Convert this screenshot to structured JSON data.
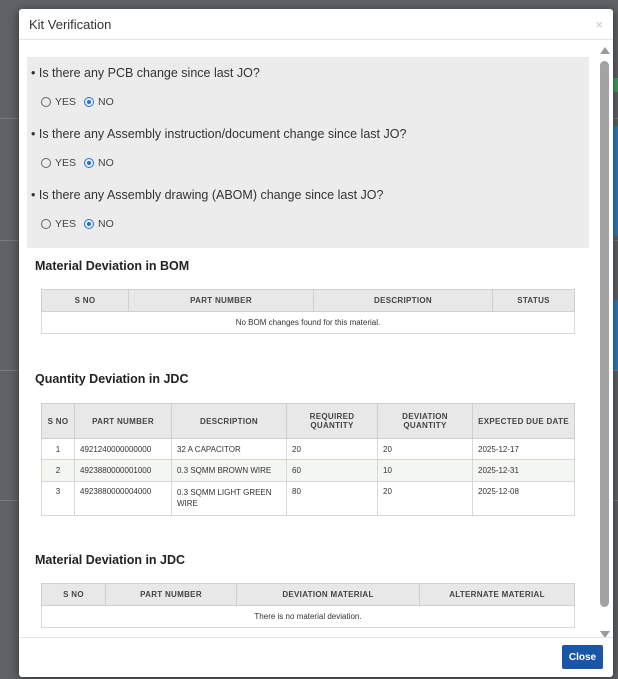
{
  "modal": {
    "title": "Kit Verification",
    "close_icon": "×",
    "close_button_label": "Close"
  },
  "questions": [
    {
      "text": "• Is there any PCB change since last JO?",
      "yes_label": "YES",
      "no_label": "NO",
      "selected": "NO"
    },
    {
      "text": "• Is there any Assembly instruction/document change since last JO?",
      "yes_label": "YES",
      "no_label": "NO",
      "selected": "NO"
    },
    {
      "text": "• Is there any Assembly drawing (ABOM) change since last JO?",
      "yes_label": "YES",
      "no_label": "NO",
      "selected": "NO"
    }
  ],
  "bom_section": {
    "title": "Material Deviation in BOM",
    "headers": [
      "S NO",
      "PART NUMBER",
      "DESCRIPTION",
      "STATUS"
    ],
    "empty_message": "No BOM changes found for this material."
  },
  "jdc_quantity_section": {
    "title": "Quantity Deviation in JDC",
    "headers": [
      "S NO",
      "PART NUMBER",
      "DESCRIPTION",
      "REQUIRED QUANTITY",
      "DEVIATION QUANTITY",
      "EXPECTED DUE DATE"
    ],
    "rows": [
      [
        "1",
        "4921240000000000",
        "32 A CAPACITOR",
        "20",
        "20",
        "2025-12-17"
      ],
      [
        "2",
        "4923880000001000",
        "0.3 SQMM BROWN WIRE",
        "60",
        "10",
        "2025-12-31"
      ],
      [
        "3",
        "4923880000004000",
        "0.3 SQMM LIGHT GREEN WIRE",
        "80",
        "20",
        "2025-12-08"
      ]
    ]
  },
  "jdc_material_section": {
    "title": "Material Deviation in JDC",
    "headers": [
      "S NO",
      "PART NUMBER",
      "DEVIATION MATERIAL",
      "ALTERNATE MATERIAL"
    ],
    "empty_message": "There is no material deviation."
  },
  "colors": {
    "accent": "#1e73d6",
    "close_button": "#1a56a6"
  }
}
